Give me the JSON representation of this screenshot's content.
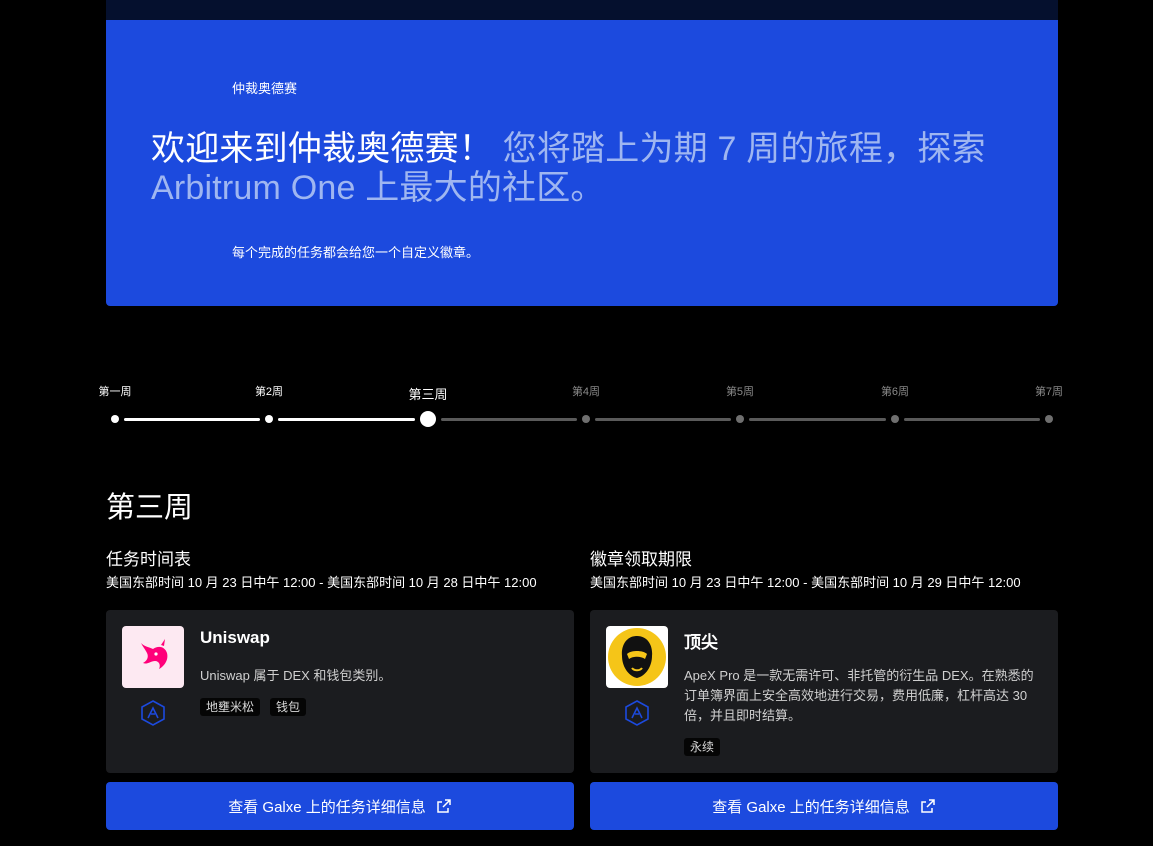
{
  "hero": {
    "eyebrow": "仲裁奥德赛",
    "headline_strong": "欢迎来到仲裁奥德赛！",
    "headline_soft": " 您将踏上为期 7 周的旅程，探索 Arbitrum One 上最大的社区。",
    "note": "每个完成的任务都会给您一个自定义徽章。"
  },
  "timeline": {
    "weeks": [
      {
        "label": "第一周",
        "state": "done"
      },
      {
        "label": "第2周",
        "state": "done"
      },
      {
        "label": "第三周",
        "state": "current"
      },
      {
        "label": "第4周",
        "state": "future"
      },
      {
        "label": "第5周",
        "state": "future"
      },
      {
        "label": "第6周",
        "state": "future"
      },
      {
        "label": "第7周",
        "state": "future"
      }
    ]
  },
  "week": {
    "title": "第三周"
  },
  "schedule": {
    "heading": "任务时间表",
    "dates": "美国东部时间 10 月 23 日中午 12:00 - 美国东部时间 10 月 28 日中午 12:00"
  },
  "badge_deadline": {
    "heading": "徽章领取期限",
    "dates": "美国东部时间 10 月 23 日中午 12:00 - 美国东部时间 10 月 29 日中午 12:00"
  },
  "cards": [
    {
      "title": "Uniswap",
      "description": "Uniswap 属于 DEX 和钱包类别。",
      "tags": [
        "地壅米松",
        "钱包"
      ],
      "logo_icon": "uniswap-unicorn-icon",
      "chain_icon": "arbitrum-icon",
      "cta": "查看 Galxe 上的任务详细信息"
    },
    {
      "title": "顶尖",
      "description": "ApeX Pro 是一款无需许可、非托管的衍生品 DEX。在熟悉的订单簿界面上安全高效地进行交易，费用低廉，杠杆高达 30 倍，并且即时结算。",
      "tags": [
        "永续"
      ],
      "logo_icon": "apex-ape-icon",
      "chain_icon": "arbitrum-icon",
      "cta": "查看 Galxe 上的任务详细信息"
    }
  ],
  "colors": {
    "accent": "#1c4ade",
    "card_bg": "#1b1c1f",
    "hero_soft_text": "#9fb6f1",
    "apex_yellow": "#f5c518"
  }
}
